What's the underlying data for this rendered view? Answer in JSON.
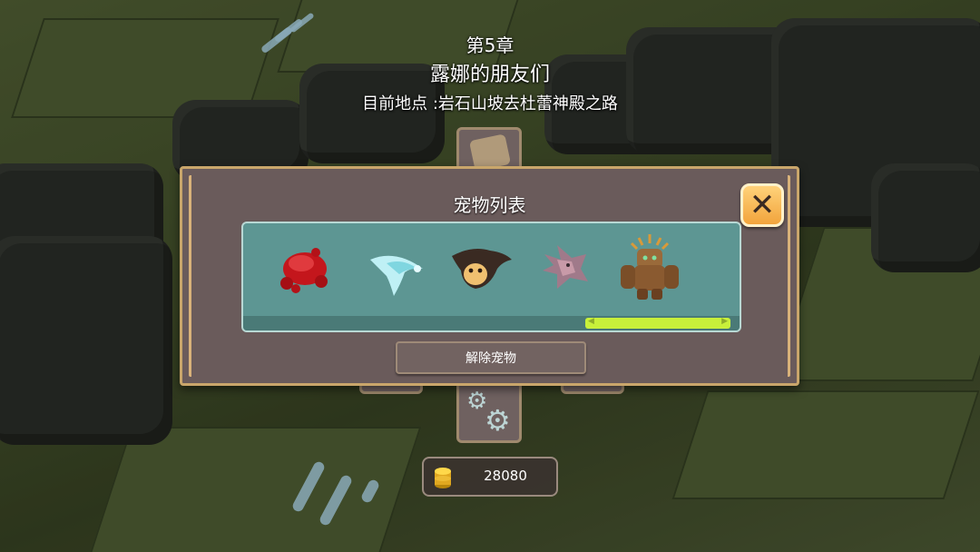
{
  "header": {
    "chapter_number": "第5章",
    "chapter_title": "露娜的朋友们",
    "location": "目前地点 :岩石山坡去杜蕾神殿之路"
  },
  "pet_panel": {
    "title": "宠物列表",
    "pets": [
      {
        "name": "red-crab-pet"
      },
      {
        "name": "ice-bird-pet"
      },
      {
        "name": "manta-pet"
      },
      {
        "name": "pink-dragon-pet"
      },
      {
        "name": "rock-golem-pet"
      }
    ],
    "scroll_position": 1.0,
    "release_label": "解除宠物"
  },
  "currency": {
    "coins": "28080",
    "icon": "gold-coin-stack-icon"
  },
  "colors": {
    "panel": "#6a5b5b",
    "panel_border": "#c9a66b",
    "list_bg": "#5d9693",
    "scroll_thumb": "#c8f03a",
    "close_button": "#f2a43c"
  }
}
